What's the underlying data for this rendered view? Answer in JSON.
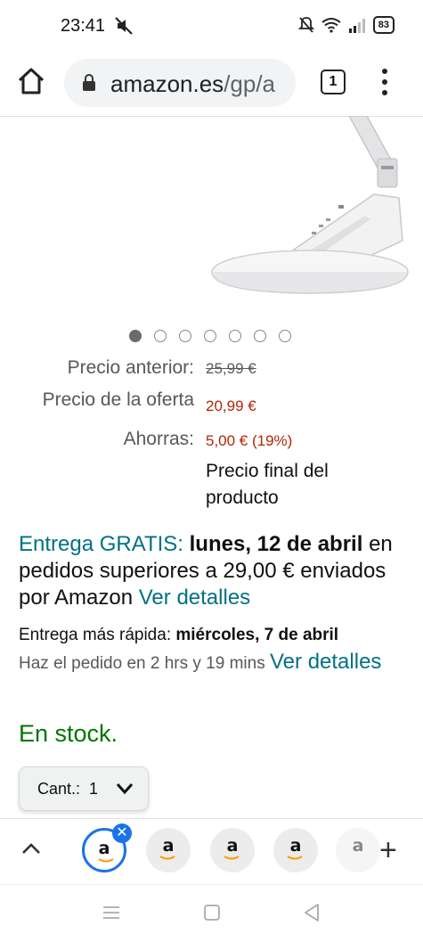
{
  "status": {
    "time": "23:41",
    "battery": "83"
  },
  "browser": {
    "url_main": "amazon.es",
    "url_path": "/gp/a",
    "tab_count": "1"
  },
  "carousel": {
    "total": 7,
    "active": 0
  },
  "pricing": {
    "prev_label": "Precio anterior:",
    "prev_value": "25,99 €",
    "offer_label": "Precio de la oferta",
    "offer_value": "20,99 €",
    "savings_label": "Ahorras:",
    "savings_value": "5,00 € (19%)",
    "final_note": "Precio final del producto"
  },
  "delivery": {
    "free_label": "Entrega GRATIS:",
    "free_date": "lunes, 12 de abril",
    "free_condition": "en pedidos superiores a 29,00 € enviados por Amazon",
    "details_link": "Ver detalles",
    "fast_label": "Entrega más rápida:",
    "fast_date": "miércoles, 7 de abril",
    "order_within": "Haz el pedido en 2 hrs y 19 mins",
    "details_link_2": "Ver detalles"
  },
  "stock": "En stock.",
  "quantity": {
    "label": "Cant.:",
    "value": "1"
  },
  "tabstrip": {
    "logo": "a"
  },
  "colors": {
    "teal": "#007185",
    "price_red": "#B12704",
    "in_stock": "#007600",
    "tab_active": "#1a73e8"
  }
}
